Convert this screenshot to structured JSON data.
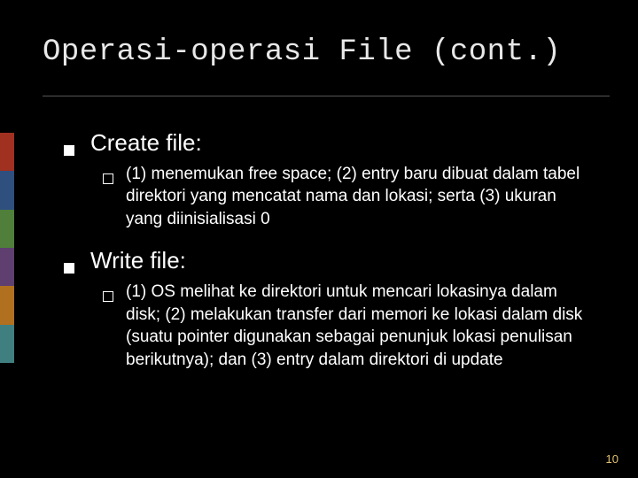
{
  "title": "Operasi-operasi File (cont.)",
  "bullets": {
    "item1": {
      "heading": "Create file:",
      "sub": "(1) menemukan free space; (2) entry baru dibuat dalam tabel direktori yang mencatat nama dan lokasi; serta (3) ukuran yang diinisialisasi 0"
    },
    "item2": {
      "heading": "Write file:",
      "sub": "(1) OS melihat ke direktori untuk mencari lokasinya dalam disk; (2) melakukan transfer dari memori ke lokasi dalam disk (suatu pointer digunakan sebagai penunjuk lokasi penulisan berikutnya); dan (3) entry dalam direktori di update"
    }
  },
  "page_number": "10"
}
